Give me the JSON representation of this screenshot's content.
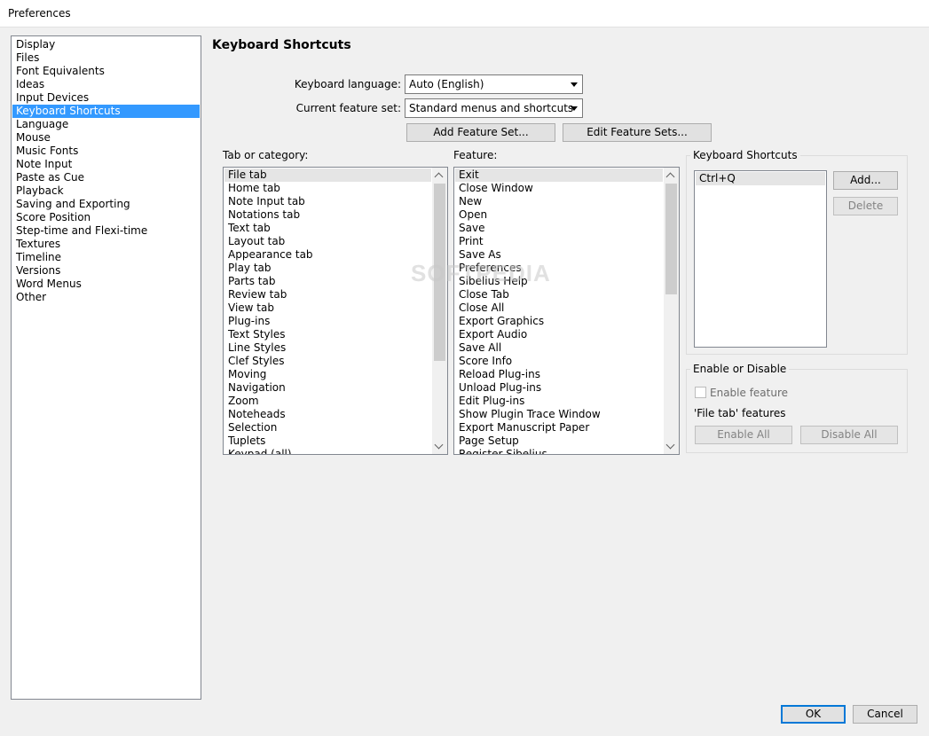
{
  "window": {
    "title": "Preferences"
  },
  "nav": {
    "items": [
      "Display",
      "Files",
      "Font Equivalents",
      "Ideas",
      "Input Devices",
      "Keyboard Shortcuts",
      "Language",
      "Mouse",
      "Music Fonts",
      "Note Input",
      "Paste as Cue",
      "Playback",
      "Saving and Exporting",
      "Score Position",
      "Step-time and Flexi-time",
      "Textures",
      "Timeline",
      "Versions",
      "Word Menus",
      "Other"
    ],
    "selected": "Keyboard Shortcuts"
  },
  "page": {
    "title": "Keyboard Shortcuts"
  },
  "keyboard_language": {
    "label": "Keyboard language:",
    "value": "Auto (English)"
  },
  "feature_set": {
    "label": "Current feature set:",
    "value": "Standard menus and shortcuts"
  },
  "buttons": {
    "add_feature_set": "Add Feature Set...",
    "edit_feature_sets": "Edit Feature Sets...",
    "add": "Add...",
    "delete": "Delete",
    "enable_all": "Enable All",
    "disable_all": "Disable All",
    "ok": "OK",
    "cancel": "Cancel"
  },
  "category_list": {
    "label": "Tab or category:",
    "items": [
      "File tab",
      "Home tab",
      "Note Input tab",
      "Notations tab",
      "Text tab",
      "Layout tab",
      "Appearance tab",
      "Play tab",
      "Parts tab",
      "Review tab",
      "View tab",
      "Plug-ins",
      "Text Styles",
      "Line Styles",
      "Clef Styles",
      "Moving",
      "Navigation",
      "Zoom",
      "Noteheads",
      "Selection",
      "Tuplets",
      "Keypad (all)"
    ],
    "selected": "File tab"
  },
  "feature_list": {
    "label": "Feature:",
    "items": [
      "Exit",
      "Close Window",
      "New",
      "Open",
      "Save",
      "Print",
      "Save As",
      "Preferences",
      "Sibelius Help",
      "Close Tab",
      "Close All",
      "Export Graphics",
      "Export Audio",
      "Save All",
      "Score Info",
      "Reload Plug-ins",
      "Unload Plug-ins",
      "Edit Plug-ins",
      "Show Plugin Trace Window",
      "Export Manuscript Paper",
      "Page Setup",
      "Register Sibelius"
    ],
    "selected": "Exit"
  },
  "shortcuts_group": {
    "title": "Keyboard Shortcuts",
    "items": [
      "Ctrl+Q"
    ]
  },
  "enable_group": {
    "title": "Enable or Disable",
    "checkbox_label": "Enable feature",
    "checkbox_checked": false,
    "features_label": "'File tab' features"
  },
  "watermark": "SOFTPEDIA"
}
